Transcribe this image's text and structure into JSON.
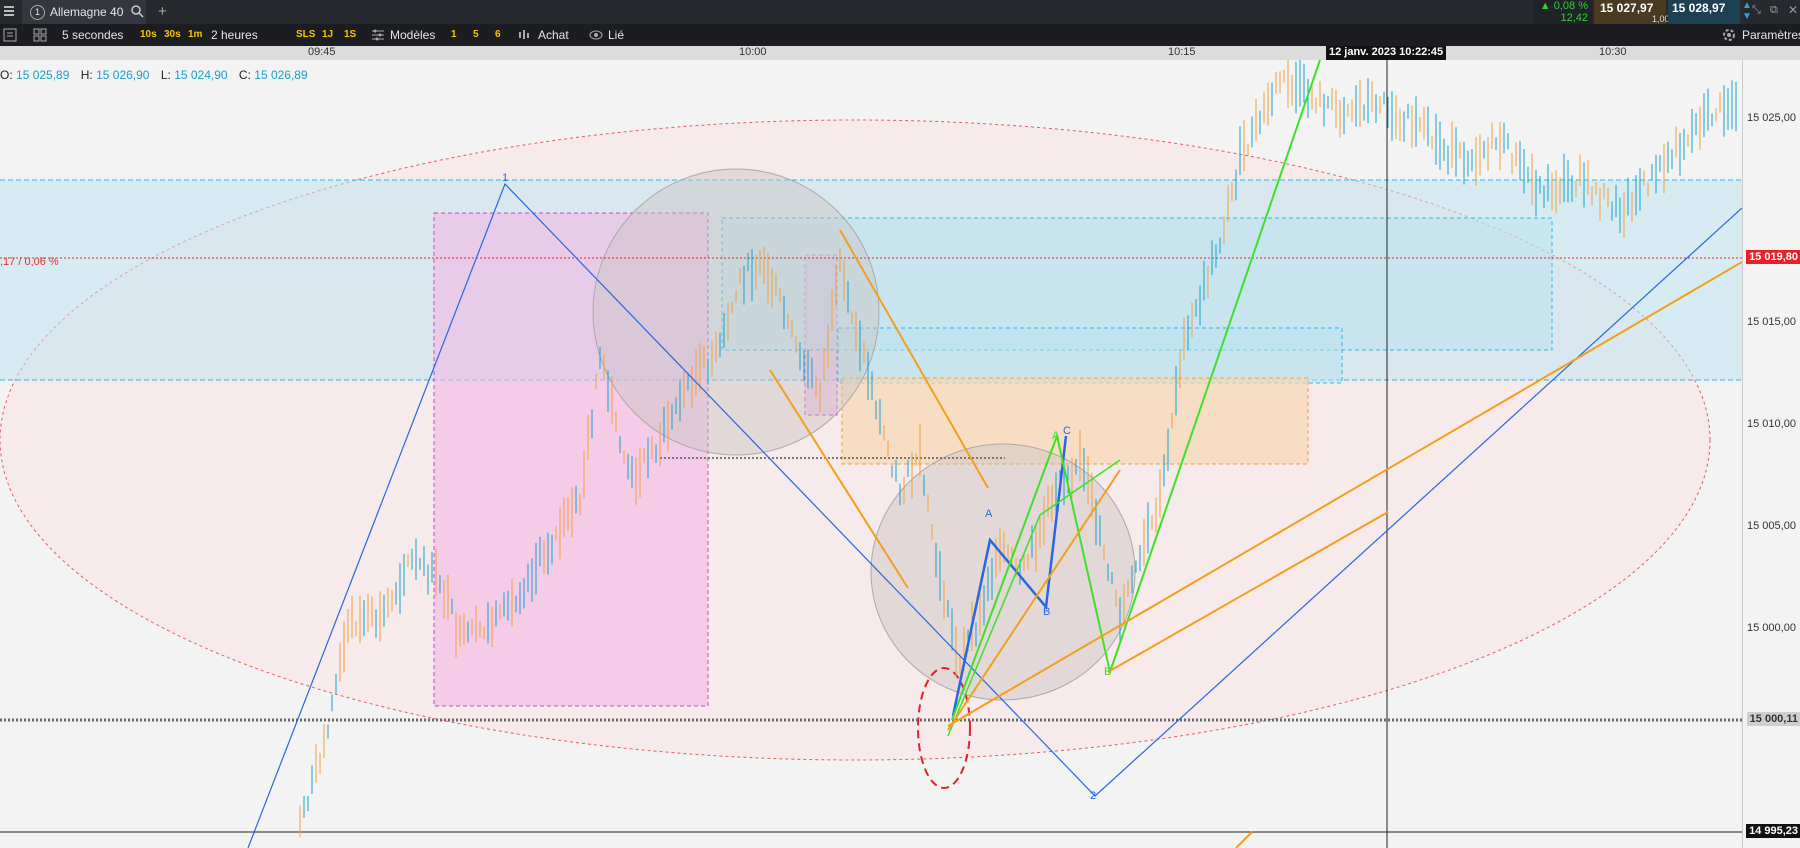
{
  "tabbar": {
    "tab_number": "1",
    "instrument": "Allemagne 40",
    "add_tab": "+",
    "change_pct": "▲ 0,08 %",
    "change_pts": "12,42",
    "bid": "15 027,97",
    "spread": "1,00",
    "ask": "15 028,97"
  },
  "toolbar": {
    "interval": "5 secondes",
    "quick_intervals": [
      "10s",
      "30s",
      "1m"
    ],
    "period": "2 heures",
    "quick_periods": [
      "SLS",
      "1J",
      "1S"
    ],
    "models": "Modèles",
    "quick_models": [
      "1",
      "5",
      "6"
    ],
    "buy": "Achat",
    "linked": "Lié",
    "settings": "Paramètres"
  },
  "timeaxis": {
    "labels": [
      "09:45",
      "10:00",
      "10:15",
      "10:30"
    ],
    "cursor_time": "12 janv. 2023 10:22:45"
  },
  "ohlc": {
    "o_label": "O:",
    "o": "15 025,89",
    "h_label": "H:",
    "h": "15 026,90",
    "l_label": "L:",
    "l": "15 024,90",
    "c_label": "C:",
    "c": "15 026,89"
  },
  "chart_overlay": {
    "variation_label": ",17 / 0,06 %",
    "wave_labels": [
      "1",
      "2",
      "A",
      "B",
      "C",
      "A",
      "B"
    ]
  },
  "price_axis": {
    "ticks": [
      "15 025,00",
      "15 015,00",
      "15 010,00",
      "15 005,00",
      "15 000,00"
    ],
    "current_price": "15 019,80",
    "level_price": "15 000,11",
    "cursor_price": "14 995,23"
  },
  "colors": {
    "up": "#1aa0c8",
    "down": "#f0a040",
    "accent_red": "#e8202a",
    "wave_blue": "#2a66e0",
    "wave_green": "#3ee02a",
    "wave_orange": "#f2a01e"
  }
}
